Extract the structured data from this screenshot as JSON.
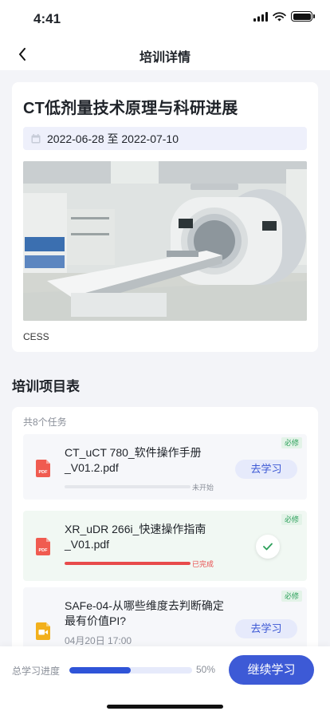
{
  "status_bar": {
    "time": "4:41"
  },
  "nav": {
    "title": "培训详情"
  },
  "course": {
    "title": "CT低剂量技术原理与科研进展",
    "date_range": "2022-06-28 至 2022-07-10",
    "org": "CESS"
  },
  "tasks_section": {
    "title": "培训项目表",
    "count_text": "共8个任务",
    "items": [
      {
        "name": "CT_uCT 780_软件操作手册_V01.2.pdf",
        "tag": "必修",
        "status": "未开始",
        "progress": 0,
        "button": "去学习"
      },
      {
        "name": "XR_uDR 266i_快速操作指南_V01.pdf",
        "tag": "必修",
        "status": "已完成",
        "progress": 1.0
      },
      {
        "name": "SAFe-04-从哪些维度去判断确定最有价值PI?",
        "tag": "必修",
        "time": "04月20日 17:00",
        "button": "去学习"
      }
    ]
  },
  "bottom": {
    "total_label": "总学习进度",
    "total_progress": 0.5,
    "total_percent": "50%",
    "continue_label": "继续学习"
  },
  "colors": {
    "accent": "#3d5ad6",
    "done": "#e84b4b",
    "required": "#2ca05a"
  }
}
